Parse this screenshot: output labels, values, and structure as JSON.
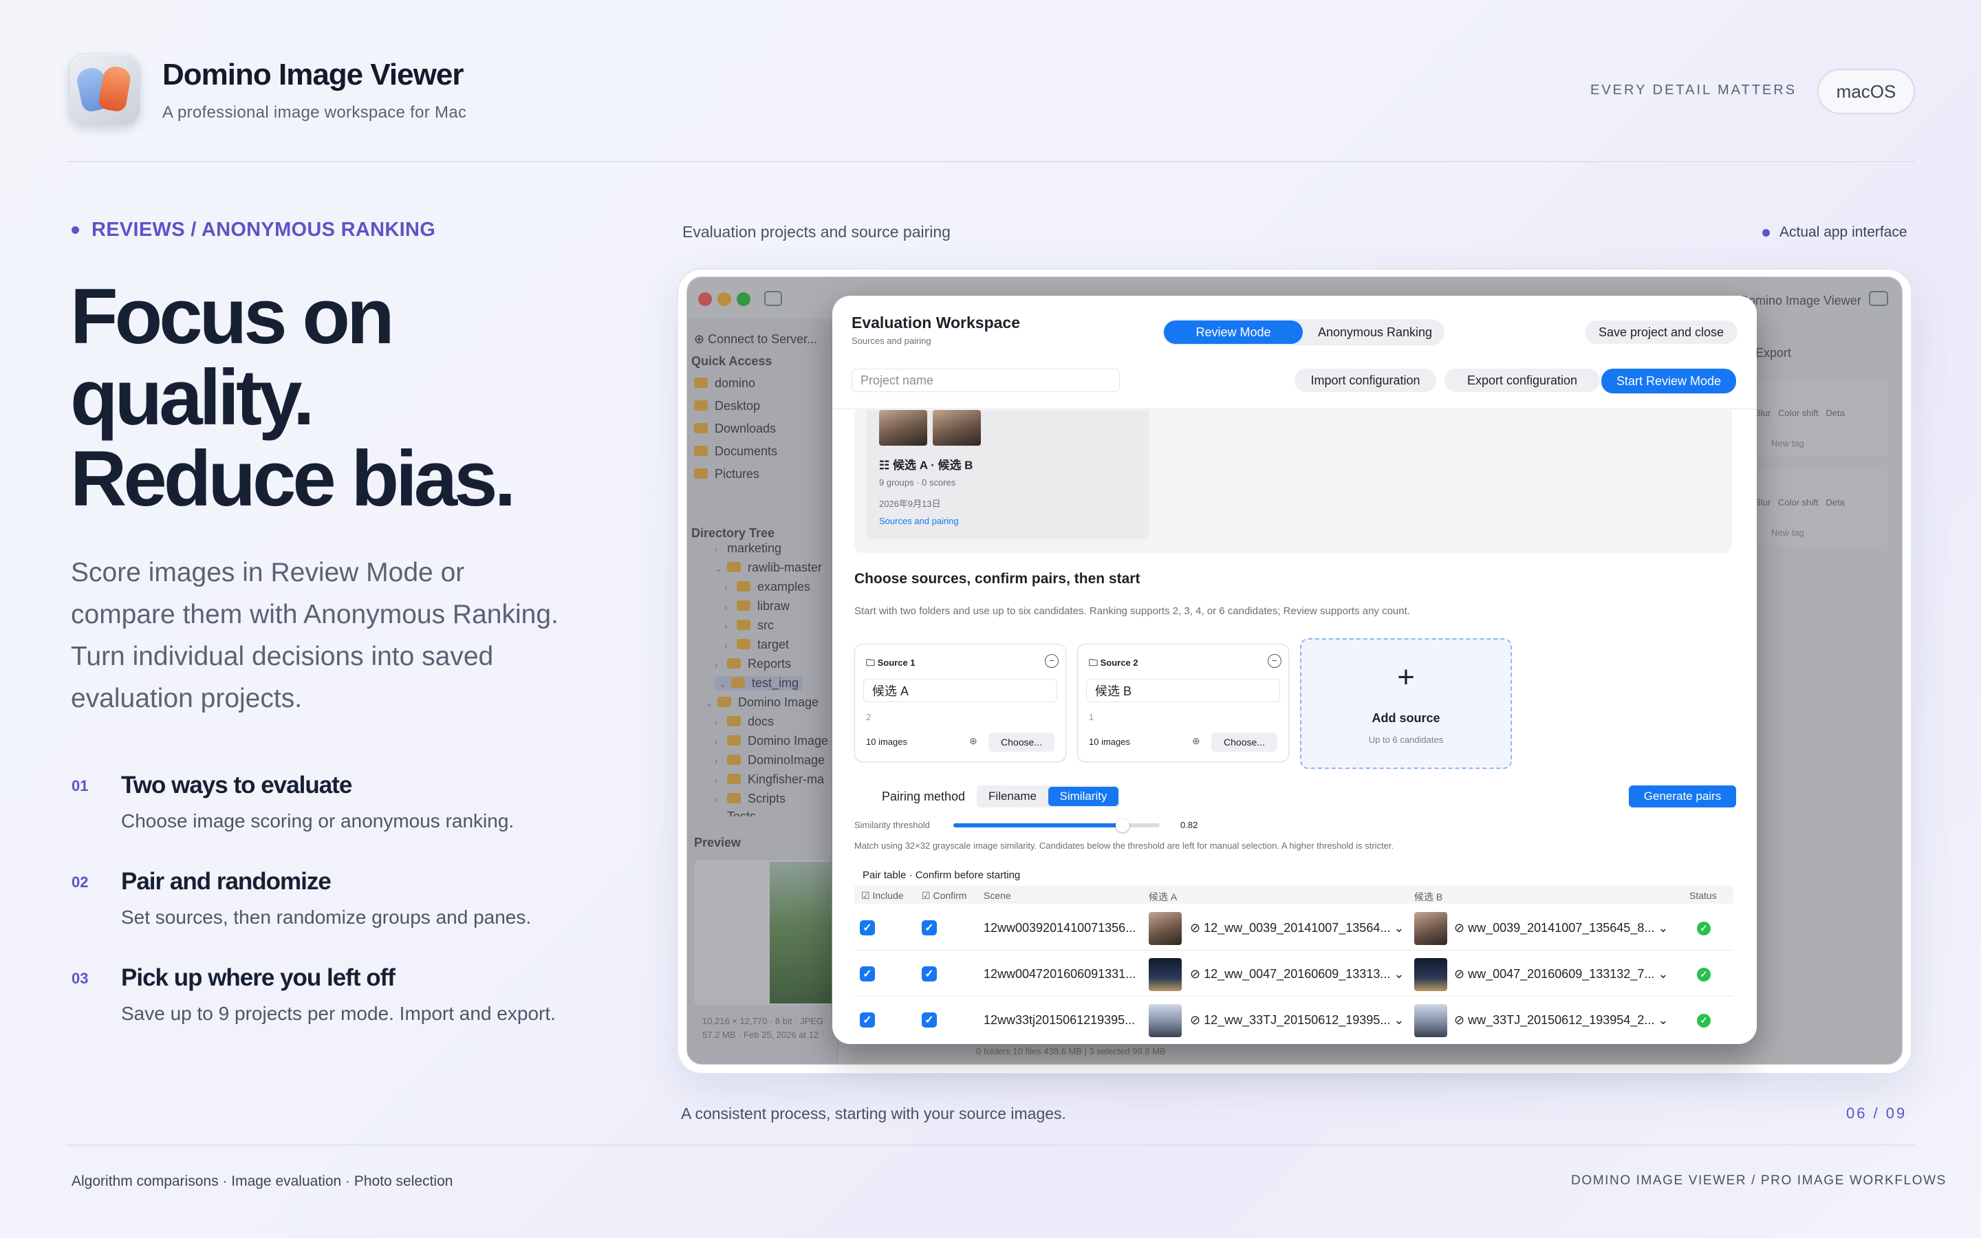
{
  "header": {
    "app_title": "Domino Image Viewer",
    "app_subtitle": "A professional image workspace for Mac",
    "tagline": "EVERY DETAIL MATTERS",
    "platform_button": "macOS"
  },
  "hero": {
    "eyebrow": "REVIEWS / ANONYMOUS RANKING",
    "headline_lines": [
      "Focus on",
      "quality.",
      "Reduce bias."
    ],
    "lead": "Score images in Review Mode or compare them with Anonymous Ranking. Turn individual decisions into saved evaluation projects."
  },
  "features": [
    {
      "num": "01",
      "title": "Two ways to evaluate",
      "desc": "Choose image scoring or anonymous ranking."
    },
    {
      "num": "02",
      "title": "Pair and randomize",
      "desc": "Set sources, then randomize groups and panes."
    },
    {
      "num": "03",
      "title": "Pick up where you left off",
      "desc": "Save up to 9 projects per mode. Import and export."
    }
  ],
  "screenshot": {
    "caption_top": "Evaluation projects and source pairing",
    "badge": "Actual app interface",
    "caption_bottom": "A consistent process, starting with your source images.",
    "pager": "06 / 09"
  },
  "footer": {
    "left": "Algorithm comparisons · Image evaluation · Photo selection",
    "right": "DOMINO IMAGE VIEWER / PRO IMAGE WORKFLOWS"
  },
  "app_window": {
    "titlebar_right": "Domino Image Viewer",
    "connect": "Connect to Server...",
    "quick_access_label": "Quick Access",
    "quick_access": [
      "domino",
      "Desktop",
      "Downloads",
      "Documents",
      "Pictures"
    ],
    "directory_tree_label": "Directory Tree",
    "tree": [
      "marketing",
      "rawlib-master",
      "examples",
      "libraw",
      "src",
      "target",
      "Reports",
      "test_img",
      "Domino Image",
      "docs",
      "Domino Image",
      "DominoImage",
      "Kingfisher-ma",
      "Scripts",
      "Tests"
    ],
    "preview_label": "Preview",
    "preview_meta_1": "10,216 × 12,770 · 8 bit · JPEG",
    "preview_meta_2": "57.2 MB · Feb 25, 2026 at 12",
    "status_bar": "0 folders   10 files   438.6 MB   |   3 selected   99.8 MB",
    "export_label": "Export",
    "right_tags": [
      "Blur",
      "Color shift",
      "Deta"
    ],
    "new_tag": "New tag"
  },
  "dialog": {
    "title": "Evaluation Workspace",
    "subtitle": "Sources and pairing",
    "tabs": [
      "Review Mode",
      "Anonymous Ranking"
    ],
    "save_close": "Save project and close",
    "project_placeholder": "Project name",
    "import_config": "Import configuration",
    "export_config": "Export configuration",
    "start_review": "Start Review Mode",
    "project_card": {
      "name": "候选 A · 候选 B",
      "meta": "9 groups · 0 scores",
      "date": "2026年9月13日",
      "link": "Sources and pairing"
    },
    "section_title": "Choose sources, confirm pairs, then start",
    "section_desc": "Start with two folders and use up to six candidates. Ranking supports 2, 3, 4, or 6 candidates; Review supports any count.",
    "sources": [
      {
        "label": "Source 1",
        "name": "候选 A",
        "index": "2",
        "count": "10 images",
        "choose": "Choose..."
      },
      {
        "label": "Source 2",
        "name": "候选 B",
        "index": "1",
        "count": "10 images",
        "choose": "Choose..."
      }
    ],
    "add_source": {
      "title": "Add source",
      "sub": "Up to 6 candidates"
    },
    "pairing_label": "Pairing method",
    "pairing_options": [
      "Filename",
      "Similarity"
    ],
    "generate": "Generate pairs",
    "threshold_label": "Similarity threshold",
    "threshold_value": "0.82",
    "threshold_fraction": 0.82,
    "threshold_note": "Match using 32×32 grayscale image similarity. Candidates below the threshold are left for manual selection. A higher threshold is stricter.",
    "table_title": "Pair table · Confirm before starting",
    "columns": [
      "Include",
      "Confirm",
      "Scene",
      "候选 A",
      "候选 B",
      "Status"
    ],
    "rows": [
      {
        "scene": "12ww0039201410071356...",
        "a": "12_ww_0039_20141007_13564...",
        "b": "ww_0039_20141007_135645_8...",
        "thumb": "portrait"
      },
      {
        "scene": "12ww0047201606091331...",
        "a": "12_ww_0047_20160609_13313...",
        "b": "ww_0047_20160609_133132_7...",
        "thumb": "night"
      },
      {
        "scene": "12ww33tj2015061219395...",
        "a": "12_ww_33TJ_20150612_19395...",
        "b": "ww_33TJ_20150612_193954_2...",
        "thumb": "street"
      }
    ]
  }
}
